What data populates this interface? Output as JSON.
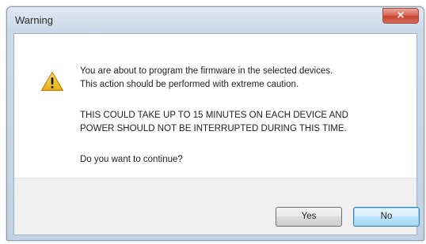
{
  "window": {
    "title": "Warning",
    "close_symbol": "×"
  },
  "dialog": {
    "icon": "warning-triangle-icon",
    "line1": "You are about to program the firmware in the selected devices.",
    "line2": "This action should be performed with extreme caution.",
    "line3": "THIS COULD TAKE UP TO 15 MINUTES ON EACH DEVICE AND",
    "line4": "POWER SHOULD NOT BE INTERRUPTED DURING THIS TIME.",
    "question": "Do you want to continue?"
  },
  "buttons": {
    "yes_label": "Yes",
    "no_label": "No"
  },
  "colors": {
    "title_bar": "#cbd9e8",
    "close_button": "#c8432f",
    "footer": "#f0f0f0",
    "warning_yellow": "#f3c623"
  }
}
